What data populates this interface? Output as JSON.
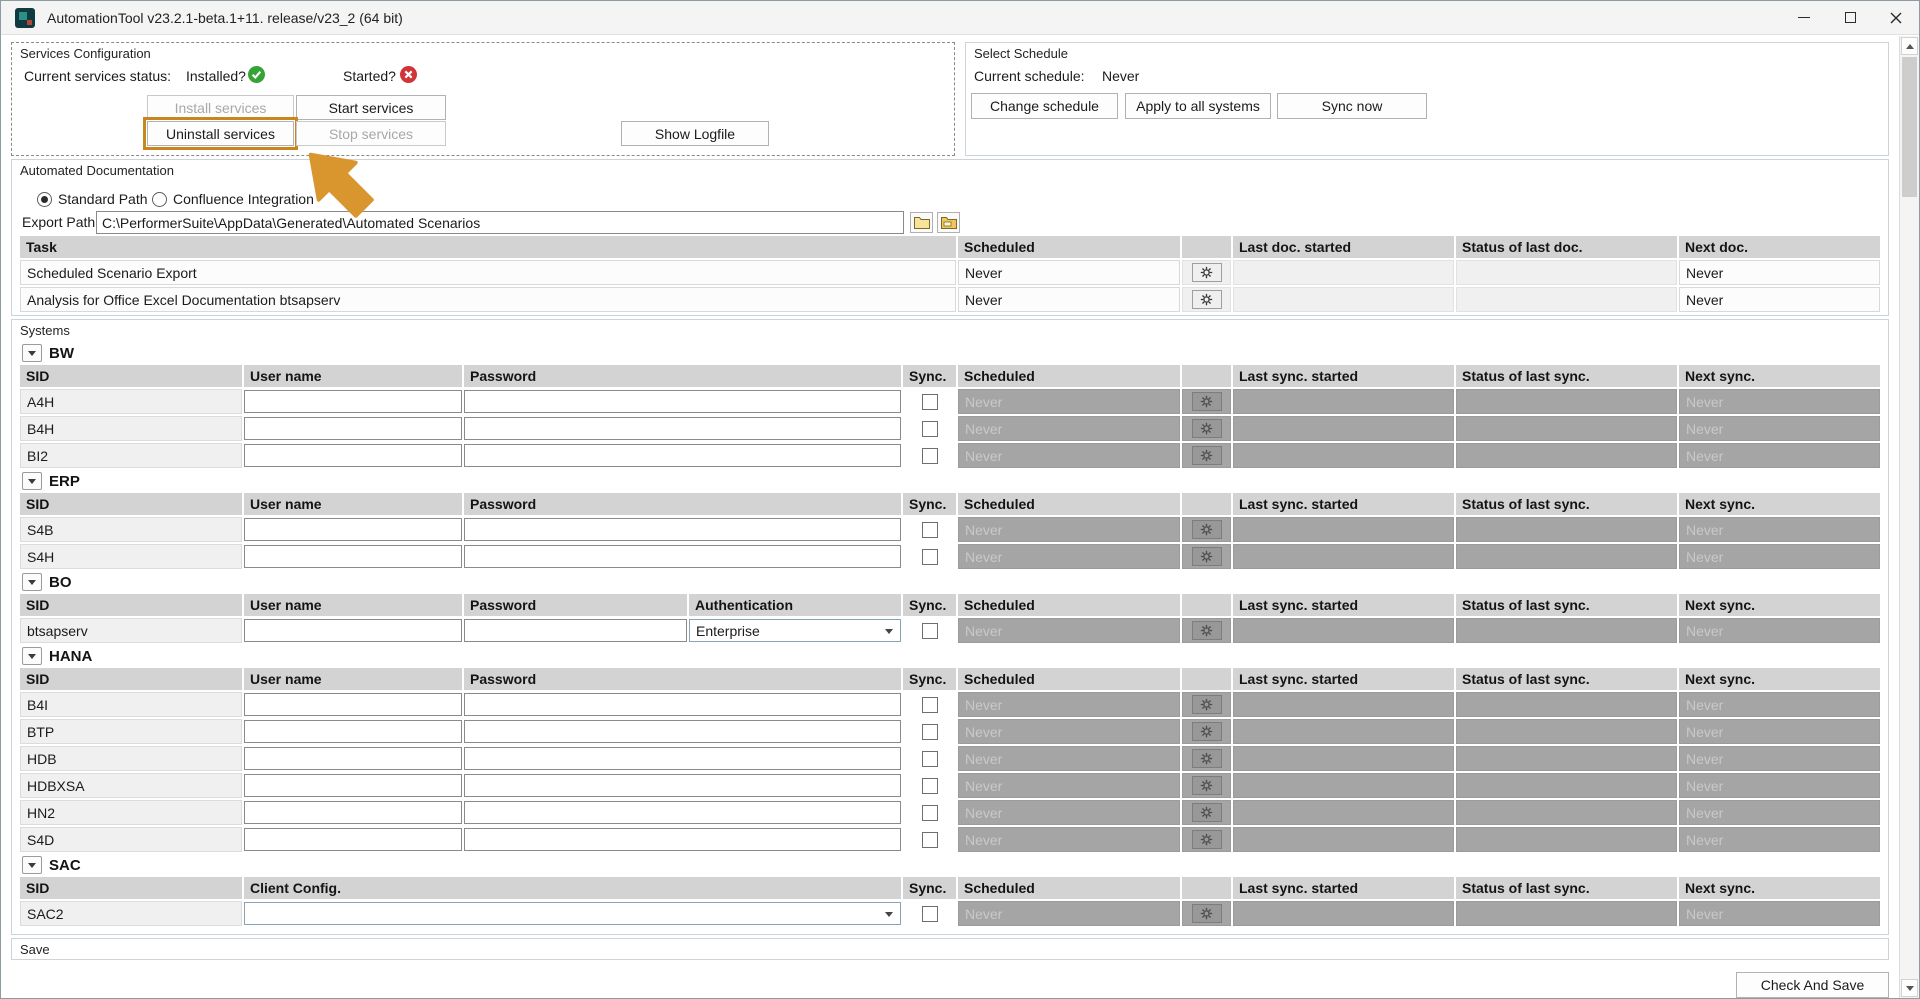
{
  "colors": {
    "highlight": "#C8861D",
    "arrow": "#D9952E",
    "installed_ok": "#36A336",
    "started_error": "#D13438",
    "disabled_cell_bg": "#A5A5A5"
  },
  "window": {
    "title": "AutomationTool v23.2.1-beta.1+11. release/v23_2 (64 bit)"
  },
  "services": {
    "label": "Services Configuration",
    "status_label": "Current services status:",
    "installed_label": "Installed?",
    "started_label": "Started?",
    "install_btn": "Install services",
    "start_btn": "Start services",
    "uninstall_btn": "Uninstall services",
    "stop_btn": "Stop services",
    "logfile_btn": "Show Logfile"
  },
  "schedule": {
    "label": "Select Schedule",
    "current_label": "Current schedule:",
    "current_value": "Never",
    "change_btn": "Change schedule",
    "apply_btn": "Apply to all systems",
    "sync_btn": "Sync now"
  },
  "docs": {
    "label": "Automated Documentation",
    "radio_standard": "Standard Path",
    "radio_confluence": "Confluence Integration",
    "export_label": "Export Path:",
    "export_value": "C:\\PerformerSuite\\AppData\\Generated\\Automated Scenarios",
    "headers": {
      "task": "Task",
      "scheduled": "Scheduled",
      "last": "Last doc. started",
      "status": "Status of last doc.",
      "next": "Next doc."
    },
    "rows": [
      {
        "task": "Scheduled Scenario Export",
        "scheduled": "Never",
        "last": "",
        "status": "",
        "next": "Never"
      },
      {
        "task": "Analysis for Office Excel Documentation btsapserv",
        "scheduled": "Never",
        "last": "",
        "status": "",
        "next": "Never"
      }
    ]
  },
  "systems": {
    "label": "Systems",
    "headers": {
      "sid": "SID",
      "user": "User name",
      "password": "Password",
      "auth": "Authentication",
      "client": "Client Config.",
      "sync": "Sync.",
      "scheduled": "Scheduled",
      "last": "Last sync. started",
      "status": "Status of last sync.",
      "next": "Next sync."
    },
    "bw": {
      "name": "BW",
      "rows": [
        {
          "sid": "A4H",
          "scheduled": "Never",
          "next": "Never"
        },
        {
          "sid": "B4H",
          "scheduled": "Never",
          "next": "Never"
        },
        {
          "sid": "BI2",
          "scheduled": "Never",
          "next": "Never"
        }
      ]
    },
    "erp": {
      "name": "ERP",
      "rows": [
        {
          "sid": "S4B",
          "scheduled": "Never",
          "next": "Never"
        },
        {
          "sid": "S4H",
          "scheduled": "Never",
          "next": "Never"
        }
      ]
    },
    "bo": {
      "name": "BO",
      "rows": [
        {
          "sid": "btsapserv",
          "auth": "Enterprise",
          "scheduled": "Never",
          "next": "Never"
        }
      ]
    },
    "hana": {
      "name": "HANA",
      "rows": [
        {
          "sid": "B4I",
          "scheduled": "Never",
          "next": "Never"
        },
        {
          "sid": "BTP",
          "scheduled": "Never",
          "next": "Never"
        },
        {
          "sid": "HDB",
          "scheduled": "Never",
          "next": "Never"
        },
        {
          "sid": "HDBXSA",
          "scheduled": "Never",
          "next": "Never"
        },
        {
          "sid": "HN2",
          "scheduled": "Never",
          "next": "Never"
        },
        {
          "sid": "S4D",
          "scheduled": "Never",
          "next": "Never"
        }
      ]
    },
    "sac": {
      "name": "SAC",
      "rows": [
        {
          "sid": "SAC2",
          "client": "",
          "scheduled": "Never",
          "next": "Never"
        }
      ]
    }
  },
  "save": {
    "label": "Save",
    "check_btn": "Check And Save"
  }
}
